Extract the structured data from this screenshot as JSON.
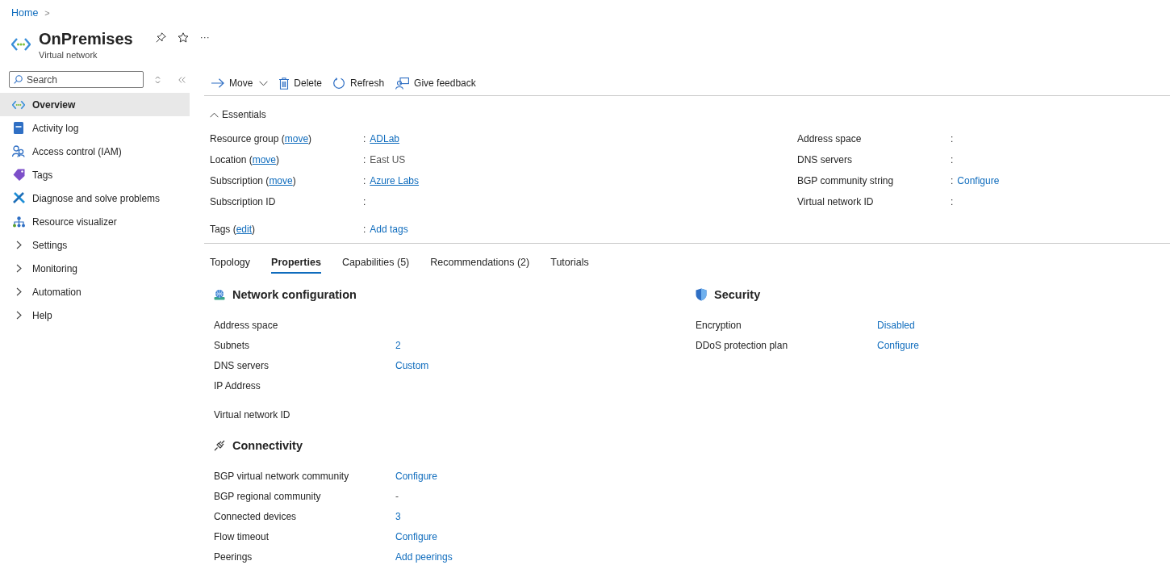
{
  "breadcrumb": {
    "items": [
      "Home"
    ],
    "separator": ">"
  },
  "header": {
    "title": "OnPremises",
    "subtitle": "Virtual network",
    "more": "···"
  },
  "sidebar": {
    "search": {
      "placeholder": "Search"
    },
    "items": [
      {
        "kind": "page",
        "label": "Overview",
        "selected": true
      },
      {
        "kind": "page",
        "label": "Activity log",
        "selected": false
      },
      {
        "kind": "page",
        "label": "Access control (IAM)",
        "selected": false
      },
      {
        "kind": "page",
        "label": "Tags",
        "selected": false
      },
      {
        "kind": "page",
        "label": "Diagnose and solve problems",
        "selected": false
      },
      {
        "kind": "page",
        "label": "Resource visualizer",
        "selected": false
      },
      {
        "kind": "group",
        "label": "Settings",
        "selected": false
      },
      {
        "kind": "group",
        "label": "Monitoring",
        "selected": false
      },
      {
        "kind": "group",
        "label": "Automation",
        "selected": false
      },
      {
        "kind": "group",
        "label": "Help",
        "selected": false
      }
    ]
  },
  "toolbar": [
    {
      "kind": "move",
      "label": "Move"
    },
    {
      "kind": "delete",
      "label": "Delete"
    },
    {
      "kind": "refresh",
      "label": "Refresh"
    },
    {
      "kind": "feedback",
      "label": "Give feedback"
    }
  ],
  "essentials": {
    "title": "Essentials",
    "expanded": true,
    "left": [
      {
        "label": "Resource group (",
        "link": "move",
        "suffix": ")",
        "separator": ":",
        "value": "ADLab",
        "kind": "link"
      },
      {
        "label": "Location (",
        "link": "move",
        "suffix": ")",
        "separator": ":",
        "value": "East US",
        "kind": "text"
      },
      {
        "label": "Subscription (",
        "link": "move",
        "suffix": ")",
        "separator": ":",
        "value": "Azure Labs",
        "kind": "link"
      },
      {
        "label": "Subscription ID",
        "separator": ":"
      },
      {
        "label": "Tags (",
        "link": "edit",
        "suffix": ")",
        "separator": ":",
        "value": "Add tags",
        "kind": "action"
      }
    ],
    "right": [
      {
        "label": "Address space",
        "separator": ":"
      },
      {
        "label": "DNS servers",
        "separator": ":"
      },
      {
        "label": "BGP community string",
        "separator": ":",
        "value": "Configure",
        "kind": "action"
      },
      {
        "label": "Virtual network ID",
        "separator": ":"
      }
    ]
  },
  "tabs": [
    {
      "label": "Topology",
      "selected": false
    },
    {
      "label": "Properties",
      "selected": true
    },
    {
      "label": "Capabilities (5)",
      "selected": false
    },
    {
      "label": "Recommendations (2)",
      "selected": false
    },
    {
      "label": "Tutorials",
      "selected": false
    }
  ],
  "sections_left": [
    {
      "kind": "network",
      "title": "Network configuration",
      "rows": [
        {
          "label": "Address space"
        },
        {
          "label": "Subnets",
          "value": "2",
          "kind": "action"
        },
        {
          "label": "DNS servers",
          "value": "Custom",
          "kind": "action"
        },
        {
          "label": "IP Address"
        },
        {
          "label": "Virtual network ID",
          "spaced": true
        }
      ]
    },
    {
      "kind": "connectivity",
      "title": "Connectivity",
      "rows": [
        {
          "label": "BGP virtual network community",
          "value": "Configure",
          "kind": "action"
        },
        {
          "label": "BGP regional community",
          "value": "-",
          "kind": "text"
        },
        {
          "label": "Connected devices",
          "value": "3",
          "kind": "action"
        },
        {
          "label": "Flow timeout",
          "value": "Configure",
          "kind": "action"
        },
        {
          "label": "Peerings",
          "value": "Add peerings",
          "kind": "action"
        }
      ]
    }
  ],
  "sections_right": [
    {
      "kind": "security",
      "title": "Security",
      "rows": [
        {
          "label": "Encryption",
          "value": "Disabled",
          "kind": "action"
        },
        {
          "label": "DDoS protection plan",
          "value": "Configure",
          "kind": "action"
        }
      ]
    }
  ]
}
